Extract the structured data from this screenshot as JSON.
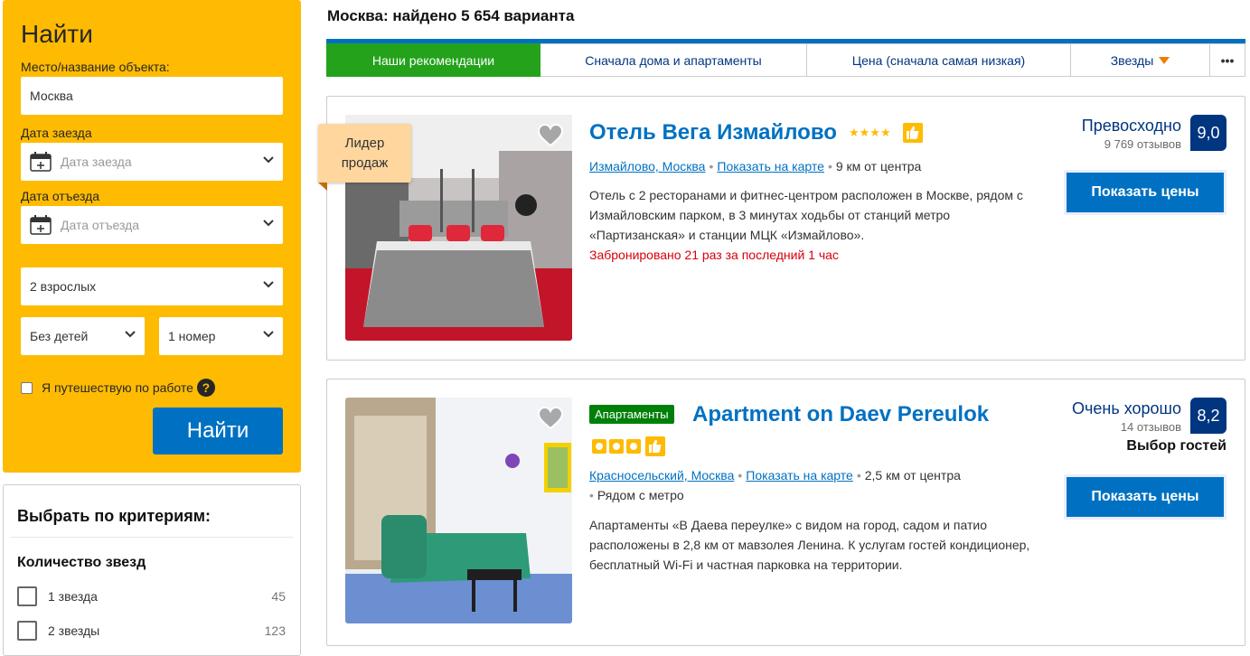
{
  "search": {
    "title": "Найти",
    "destination_label": "Место/название объекта:",
    "destination_value": "Москва",
    "checkin_label": "Дата заезда",
    "checkin_placeholder": "Дата заезда",
    "checkout_label": "Дата отъезда",
    "checkout_placeholder": "Дата отъезда",
    "adults_value": "2 взрослых",
    "children_value": "Без детей",
    "rooms_value": "1 номер",
    "business_label": "Я путешествую по работе",
    "submit_label": "Найти"
  },
  "filters": {
    "title": "Выбрать по критериям:",
    "stars_heading": "Количество звезд",
    "items": [
      {
        "label": "1 звезда",
        "count": "45"
      },
      {
        "label": "2 звезды",
        "count": "123"
      }
    ]
  },
  "results": {
    "heading": "Москва: найдено 5 654 варианта",
    "sort_tabs": [
      {
        "label": "Наши рекомендации"
      },
      {
        "label": "Сначала дома и апартаменты"
      },
      {
        "label": "Цена (сначала самая низкая)"
      },
      {
        "label": "Звезды"
      },
      {
        "label": "•••"
      }
    ],
    "hotels": [
      {
        "ribbon": "Лидер продаж",
        "name": "Отель Вега Измайлово",
        "stars": "★★★★",
        "district": "Измайлово, Москва",
        "map_link": "Показать на карте",
        "distance": "9 км от центра",
        "description": "Отель с 2 ресторанами и фитнес-центром расположен в Москве, рядом с Измайловским парком, в 3 минутах ходьбы от станций метро «Партизанская» и станции МЦК «Измайлово».",
        "booked": "Забронировано 21 раз за последний 1 час",
        "rating_word": "Превосходно",
        "reviews": "9 769 отзывов",
        "score": "9,0",
        "price_button": "Показать цены"
      },
      {
        "type_badge": "Апартаменты",
        "name": "Apartment on Daev Pereulok",
        "district": "Красносельский, Москва",
        "map_link": "Показать на карте",
        "distance": "2,5 км от центра",
        "metro": "Рядом с метро",
        "description": "Апартаменты «В Даева переулке» с видом на город, садом и патио расположены в 2,8 км от мавзолея Ленина. К услугам гостей кондиционер, бесплатный Wi-Fi и частная парковка на территории.",
        "rating_word": "Очень хорошо",
        "reviews": "14 отзывов",
        "score": "8,2",
        "guest_choice": "Выбор гостей",
        "price_button": "Показать цены"
      }
    ]
  },
  "colors": {
    "search_panel": "#febb02",
    "brand_blue": "#0071c2",
    "dark_blue": "#003580",
    "active_tab": "#24a21c"
  }
}
